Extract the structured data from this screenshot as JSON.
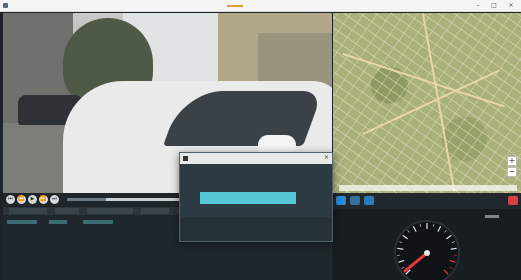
{
  "window": {
    "title": "",
    "minimize_icon": "minimize-icon",
    "maximize_icon": "maximize-icon",
    "close_icon": "close-icon"
  },
  "video": {
    "scene": "street with parked white car"
  },
  "controls": {
    "buttons": [
      "skip-back-icon",
      "rewind-icon",
      "play-icon",
      "fast-forward-icon",
      "skip-forward-icon"
    ],
    "progress": 0.15
  },
  "map": {
    "zoom_in_label": "+",
    "zoom_out_label": "−"
  },
  "dialog": {
    "title": "",
    "message": "",
    "button_label": "",
    "progress": 1.0,
    "accent_color": "#57c6d6"
  },
  "gauge": {
    "needle_color": "#e23a3a",
    "accent_color": "#ffffff"
  },
  "colors": {
    "background": "#1d2327",
    "accent": "#4ea0a8",
    "toolbar_blue": "#2a8ad4"
  }
}
